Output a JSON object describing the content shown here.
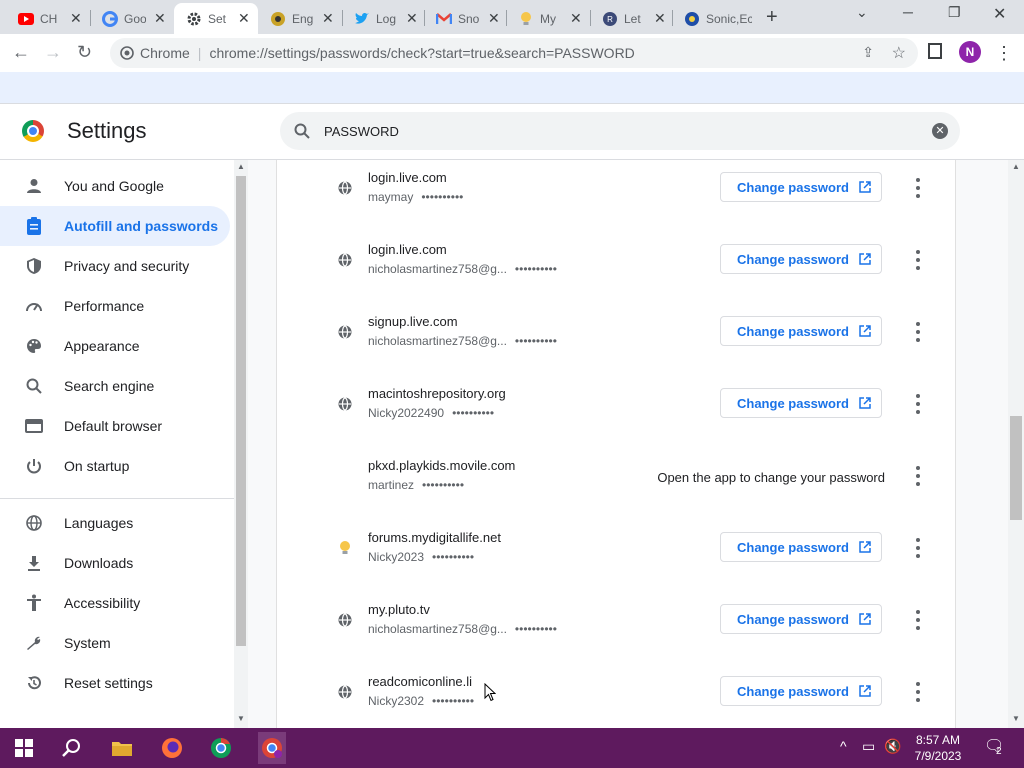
{
  "browser": {
    "tabs": [
      {
        "title": "CH",
        "icon": "youtube-icon"
      },
      {
        "title": "Goo",
        "icon": "google-icon"
      },
      {
        "title": "Set",
        "icon": "settings-gear-icon",
        "active": true
      },
      {
        "title": "Eng",
        "icon": "globe-icon"
      },
      {
        "title": "Log",
        "icon": "twitter-icon"
      },
      {
        "title": "Sno",
        "icon": "gmail-icon"
      },
      {
        "title": "My",
        "icon": "bulb-icon"
      },
      {
        "title": "Let",
        "icon": "site-icon"
      },
      {
        "title": "Sonic,Ec",
        "icon": "sonic-icon"
      }
    ],
    "omnibox": {
      "site_label": "Chrome",
      "url": "chrome://settings/passwords/check?start=true&search=PASSWORD"
    },
    "profile_initial": "N"
  },
  "settings": {
    "title": "Settings",
    "search_query": "PASSWORD",
    "sidebar": [
      {
        "label": "You and Google",
        "icon": "person-icon"
      },
      {
        "label": "Autofill and passwords",
        "icon": "clipboard-icon",
        "selected": true
      },
      {
        "label": "Privacy and security",
        "icon": "shield-icon"
      },
      {
        "label": "Performance",
        "icon": "speedometer-icon"
      },
      {
        "label": "Appearance",
        "icon": "palette-icon"
      },
      {
        "label": "Search engine",
        "icon": "search-icon"
      },
      {
        "label": "Default browser",
        "icon": "browser-window-icon"
      },
      {
        "label": "On startup",
        "icon": "power-icon"
      },
      {
        "label": "Languages",
        "icon": "globe-icon"
      },
      {
        "label": "Downloads",
        "icon": "download-icon"
      },
      {
        "label": "Accessibility",
        "icon": "accessibility-icon"
      },
      {
        "label": "System",
        "icon": "wrench-icon"
      },
      {
        "label": "Reset settings",
        "icon": "reset-icon"
      }
    ],
    "passwords": [
      {
        "site": "login.live.com",
        "username": "maymay",
        "password_mask": "••••••••••",
        "icon": "globe-icon",
        "action": "Change password"
      },
      {
        "site": "login.live.com",
        "username": "nicholasmartinez758@g...",
        "password_mask": "••••••••••",
        "icon": "globe-icon",
        "action": "Change password"
      },
      {
        "site": "signup.live.com",
        "username": "nicholasmartinez758@g...",
        "password_mask": "••••••••••",
        "icon": "globe-icon",
        "action": "Change password"
      },
      {
        "site": "macintoshrepository.org",
        "username": "Nicky2022490",
        "password_mask": "••••••••••",
        "icon": "globe-icon",
        "action": "Change password"
      },
      {
        "site": "pkxd.playkids.movile.com",
        "username": "martinez",
        "password_mask": "••••••••••",
        "icon": "",
        "action_text": "Open the app to change your password"
      },
      {
        "site": "forums.mydigitallife.net",
        "username": "Nicky2023",
        "password_mask": "••••••••••",
        "icon": "bulb-icon",
        "action": "Change password"
      },
      {
        "site": "my.pluto.tv",
        "username": "nicholasmartinez758@g...",
        "password_mask": "••••••••••",
        "icon": "globe-icon",
        "action": "Change password"
      },
      {
        "site": "readcomiconline.li",
        "username": "Nicky2302",
        "password_mask": "••••••••••",
        "icon": "globe-icon",
        "action": "Change password"
      }
    ]
  },
  "taskbar": {
    "time": "8:57 AM",
    "date": "7/9/2023",
    "notification_count": "2",
    "accent": "#5e1a5e"
  }
}
